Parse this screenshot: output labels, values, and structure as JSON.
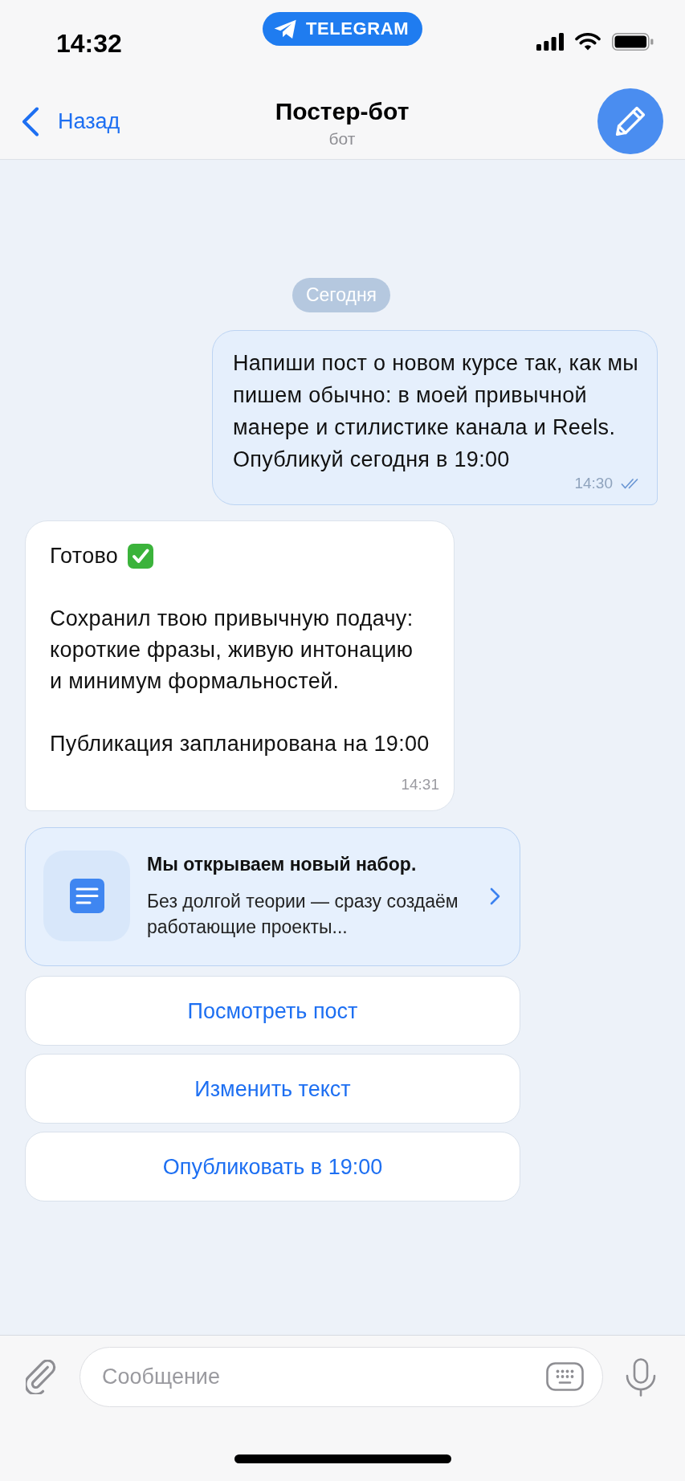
{
  "status_bar": {
    "time": "14:32",
    "app_pill": "TELEGRAM"
  },
  "header": {
    "back": "Назад",
    "title": "Постер-бот",
    "subtitle": "бот"
  },
  "date_divider": "Сегодня",
  "messages": [
    {
      "kind": "outgoing",
      "paragraphs": [
        {
          "kind": "plain",
          "text": "Напиши пост о новом курсе так, как мы\nпишем обычно: в моей привычной\nманере и стилистике канала и Reels.\nОпубликуй сегодня в 19:00"
        }
      ],
      "time": "14:30",
      "read": true
    },
    {
      "kind": "incoming",
      "paragraphs": [
        {
          "kind": "done",
          "text": "Готово"
        },
        {
          "kind": "plain",
          "text": "Сохранил твою привычную подачу:\nкороткие фразы, живую интонацию\nи минимум формальностей."
        },
        {
          "kind": "plain",
          "text": "Публикация запланирована на 19:00"
        }
      ],
      "time": "14:31"
    }
  ],
  "post_preview": {
    "title": "Мы открываем новый набор.",
    "excerpt": "Без долгой теории — сразу создаём\nработающие проекты..."
  },
  "inline_buttons": [
    {
      "label": "Посмотреть пост"
    },
    {
      "label": "Изменить текст"
    },
    {
      "label": "Опубликовать в 19:00"
    }
  ],
  "composer": {
    "placeholder": "Сообщение"
  }
}
